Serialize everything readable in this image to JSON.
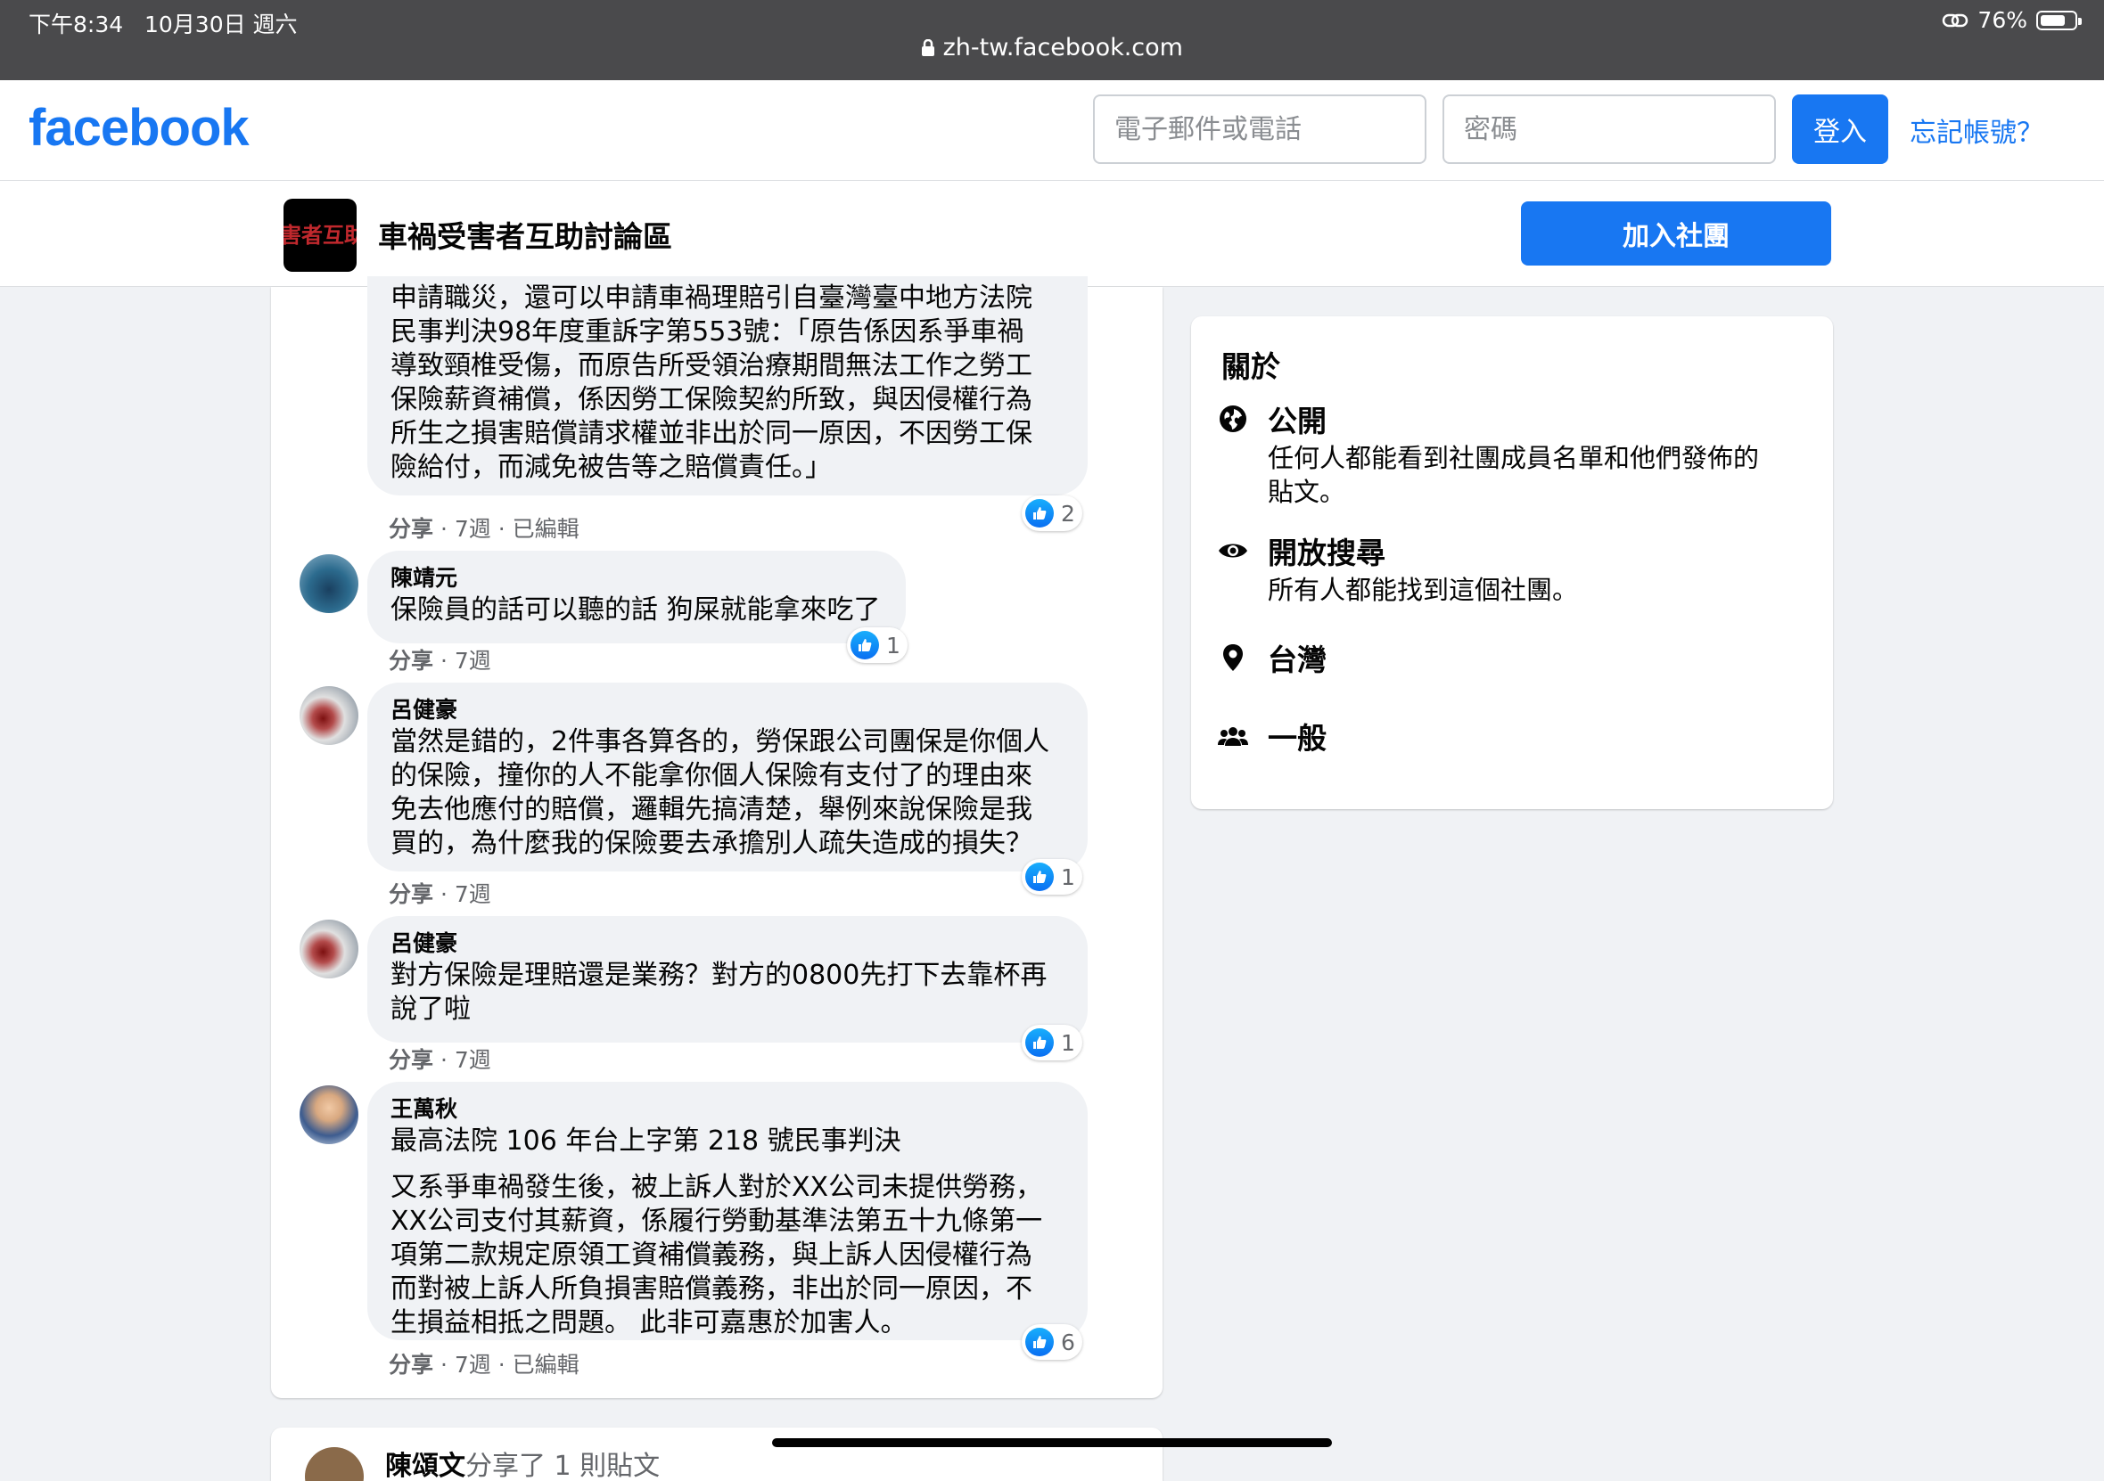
{
  "status_bar": {
    "time": "下午8:34",
    "date": "10月30日 週六",
    "battery": "76%",
    "battery_level": 0.76,
    "url": "zh-tw.facebook.com"
  },
  "header": {
    "logo": "facebook",
    "email_placeholder": "電子郵件或電話",
    "password_placeholder": "密碼",
    "login_label": "登入",
    "forgot_label": "忘記帳號？"
  },
  "group": {
    "avatar_text": "害者互助",
    "name": "車禍受害者互助討論區",
    "join_label": "加入社團"
  },
  "comments": [
    {
      "author": "",
      "text": "申請職災，還可以申請車禍理賠引自臺灣臺中地方法院\n民事判決98年度重訴字第553號：「原告係因系爭車禍\n導致頸椎受傷，而原告所受領治療期間無法工作之勞工\n保險薪資補償，係因勞工保險契約所致，與因侵權行為\n所生之損害賠償請求權並非出於同一原因，不因勞工保\n險給付，而減免被告等之賠償責任。」",
      "share": "分享",
      "time": "7週",
      "edited": "已編輯",
      "likes": "2"
    },
    {
      "author": "陳靖元",
      "text": "保險員的話可以聽的話 狗屎就能拿來吃了",
      "share": "分享",
      "time": "7週",
      "likes": "1"
    },
    {
      "author": "呂健豪",
      "text": "當然是錯的，2件事各算各的，勞保跟公司團保是你個人\n的保險，撞你的人不能拿你個人保險有支付了的理由來\n免去他應付的賠償，邏輯先搞清楚，舉例來說保險是我\n買的，為什麼我的保險要去承擔別人疏失造成的損失？",
      "share": "分享",
      "time": "7週",
      "likes": "1"
    },
    {
      "author": "呂健豪",
      "text": "對方保險是理賠還是業務？對方的0800先打下去靠杯再\n說了啦",
      "share": "分享",
      "time": "7週",
      "likes": "1"
    },
    {
      "author": "王萬秋",
      "text": "最高法院 106 年台上字第 218 號民事判決",
      "text2": "又系爭車禍發生後，被上訴人對於XX公司未提供勞務，\nXX公司支付其薪資，係履行勞動基準法第五十九條第一\n項第二款規定原領工資補償義務，與上訴人因侵權行為\n而對被上訴人所負損害賠償義務，非出於同一原因，不\n生損益相抵之問題。 此非可嘉惠於加害人。",
      "share": "分享",
      "time": "7週",
      "edited": "已編輯",
      "likes": "6"
    }
  ],
  "next_post": {
    "author": "陳頌文",
    "action": "分享了 1 則貼文"
  },
  "about": {
    "title": "關於",
    "items": [
      {
        "icon": "globe-icon",
        "title": "公開",
        "desc": "任何人都能看到社團成員名單和他們發佈的\n貼文。"
      },
      {
        "icon": "eye-icon",
        "title": "開放搜尋",
        "desc": "所有人都能找到這個社團。"
      },
      {
        "icon": "location-pin-icon",
        "title": "台灣",
        "desc": ""
      },
      {
        "icon": "people-icon",
        "title": "一般",
        "desc": ""
      }
    ]
  },
  "colors": {
    "brand": "#1877f2",
    "page_bg": "#f0f2f5",
    "status_bar": "#4a4a4c"
  }
}
